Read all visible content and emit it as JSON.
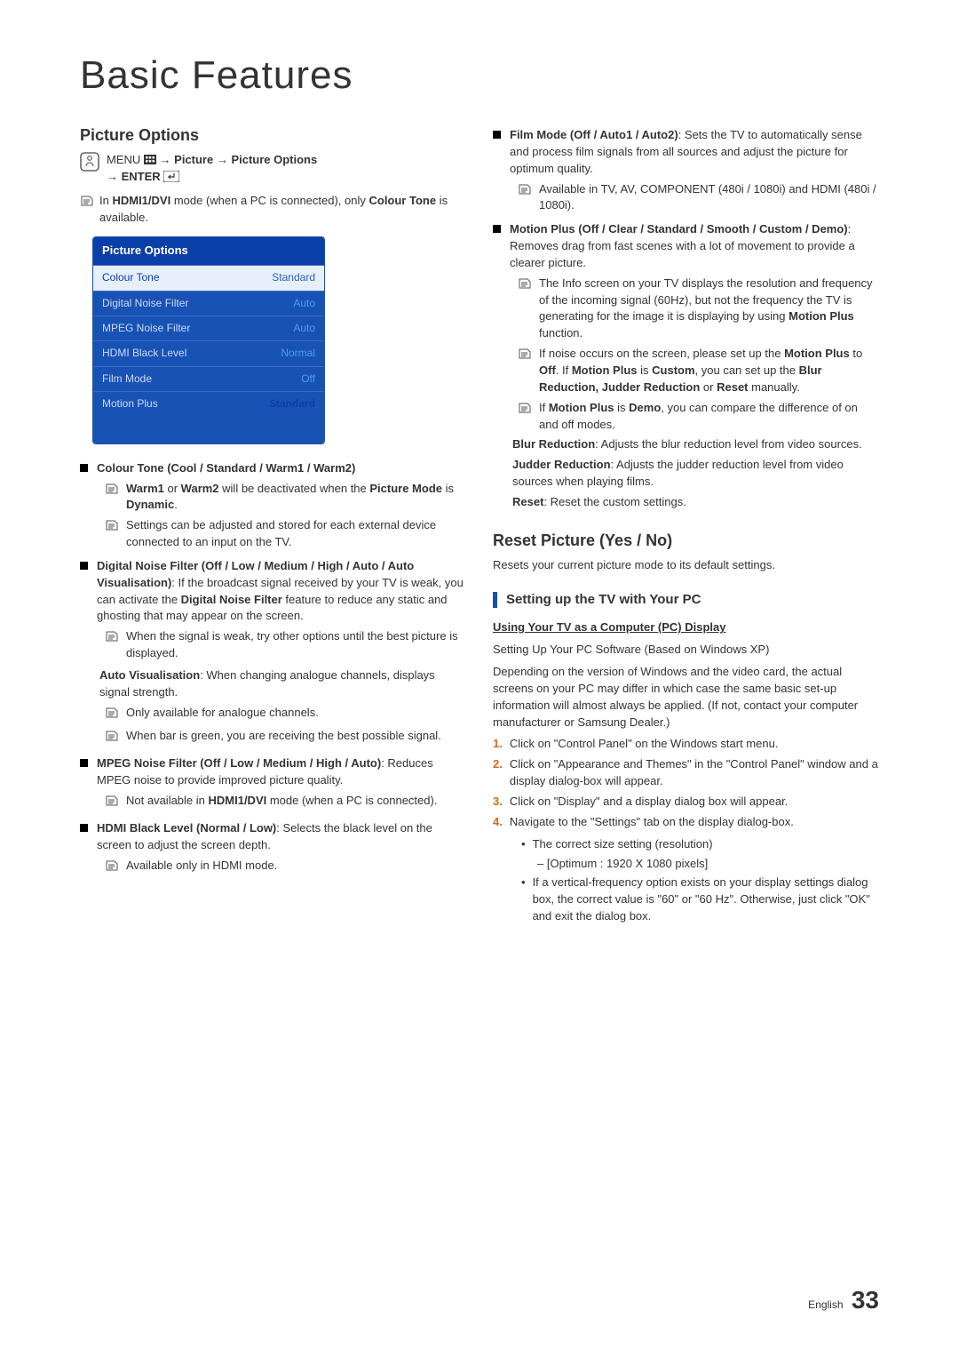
{
  "title": "Basic Features",
  "left": {
    "heading": "Picture Options",
    "nav": {
      "line1_pre": "MENU",
      "line1_mid": " → Picture → Picture Options",
      "line2": "→ ENTER"
    },
    "intro_note": "In HDMI1/DVI mode (when a PC is connected), only Colour Tone is available.",
    "osd": {
      "title": "Picture Options",
      "rows": [
        {
          "label": "Colour Tone",
          "value": "Standard",
          "active": true
        },
        {
          "label": "Digital Noise Filter",
          "value": "Auto"
        },
        {
          "label": "MPEG Noise Filter",
          "value": "Auto"
        },
        {
          "label": "HDMI Black Level",
          "value": "Normal"
        },
        {
          "label": "Film Mode",
          "value": "Off"
        },
        {
          "label": "Motion Plus",
          "value": "Standard",
          "standard": true
        }
      ]
    },
    "items": [
      {
        "title_html": "Colour Tone (Cool / Standard / Warm1 / Warm2)",
        "notes": [
          "Warm1 or Warm2 will be deactivated when the Picture Mode is Dynamic.",
          "Settings can be adjusted and stored for each external device connected to an input on the TV."
        ]
      },
      {
        "title_html": "Digital Noise Filter (Off / Low / Medium / High / Auto / Auto Visualisation): If the broadcast signal received by your TV is weak, you can activate the Digital Noise Filter feature to reduce any static and ghosting that may appear on the screen.",
        "notes": [
          "When the signal is weak, try other options until the best picture is displayed."
        ],
        "extra_label": "Auto Visualisation",
        "extra_text": ": When changing analogue channels, displays signal strength.",
        "notes2": [
          "Only available for analogue channels.",
          "When bar is green, you are receiving the best possible signal."
        ]
      },
      {
        "title_html": "MPEG Noise Filter (Off / Low / Medium / High / Auto): Reduces MPEG noise to provide improved picture quality.",
        "notes": [
          "Not available in HDMI1/DVI mode (when a PC is connected)."
        ]
      },
      {
        "title_html": "HDMI Black Level (Normal / Low): Selects the black level on the screen to adjust the screen depth.",
        "notes": [
          "Available only in HDMI mode."
        ]
      }
    ]
  },
  "right": {
    "items": [
      {
        "title_html": "Film Mode (Off / Auto1 / Auto2): Sets the TV to automatically sense and process film signals from all sources and adjust the picture for optimum quality.",
        "notes": [
          "Available in TV, AV, COMPONENT (480i / 1080i) and HDMI (480i / 1080i)."
        ]
      },
      {
        "title_html": "Motion Plus (Off / Clear / Standard / Smooth / Custom / Demo): Removes drag from fast scenes with a lot of movement to provide a clearer picture.",
        "notes": [
          "The Info screen on your TV displays the resolution and frequency of the incoming signal (60Hz), but not the frequency the TV is generating for the image it is displaying by using Motion Plus function.",
          "If noise occurs on the screen, please set up the Motion Plus to Off. If Motion Plus is Custom, you can set up the Blur Reduction, Judder Reduction or Reset manually.",
          "If Motion Plus is Demo, you can compare the difference of on and off modes."
        ],
        "post": [
          {
            "label": "Blur Reduction",
            "text": ": Adjusts the blur reduction level from video sources."
          },
          {
            "label": "Judder Reduction",
            "text": ": Adjusts the judder reduction level from video sources when playing films."
          },
          {
            "label": "Reset",
            "text": ": Reset the custom settings."
          }
        ]
      }
    ],
    "reset_heading": "Reset Picture (Yes / No)",
    "reset_text": "Resets your current picture mode to its default settings.",
    "section": "Setting up the TV with Your PC",
    "pc_sub": "Using Your TV as a Computer (PC) Display",
    "pc_line1": "Setting Up Your PC Software (Based on Windows XP)",
    "pc_line2": "Depending on the version of Windows and the video card, the actual screens on your PC may differ in which case the same basic set-up information will almost always be applied. (If not, contact your computer manufacturer or Samsung Dealer.)",
    "steps": [
      "Click on \"Control Panel\" on the Windows start menu.",
      "Click on \"Appearance and Themes\" in the \"Control Panel\" window and a display dialog-box will appear.",
      "Click on \"Display\" and a display dialog box will appear.",
      "Navigate to the \"Settings\" tab on the display dialog-box."
    ],
    "step4_bullets": [
      {
        "text": "The correct size setting (resolution)",
        "dash": "[Optimum : 1920 X 1080 pixels]"
      },
      {
        "text": "If a vertical-frequency option exists on your display settings dialog box, the correct value is \"60\" or \"60 Hz\". Otherwise, just click \"OK\" and exit the dialog box."
      }
    ]
  },
  "footer": {
    "lang": "English",
    "page": "33"
  }
}
